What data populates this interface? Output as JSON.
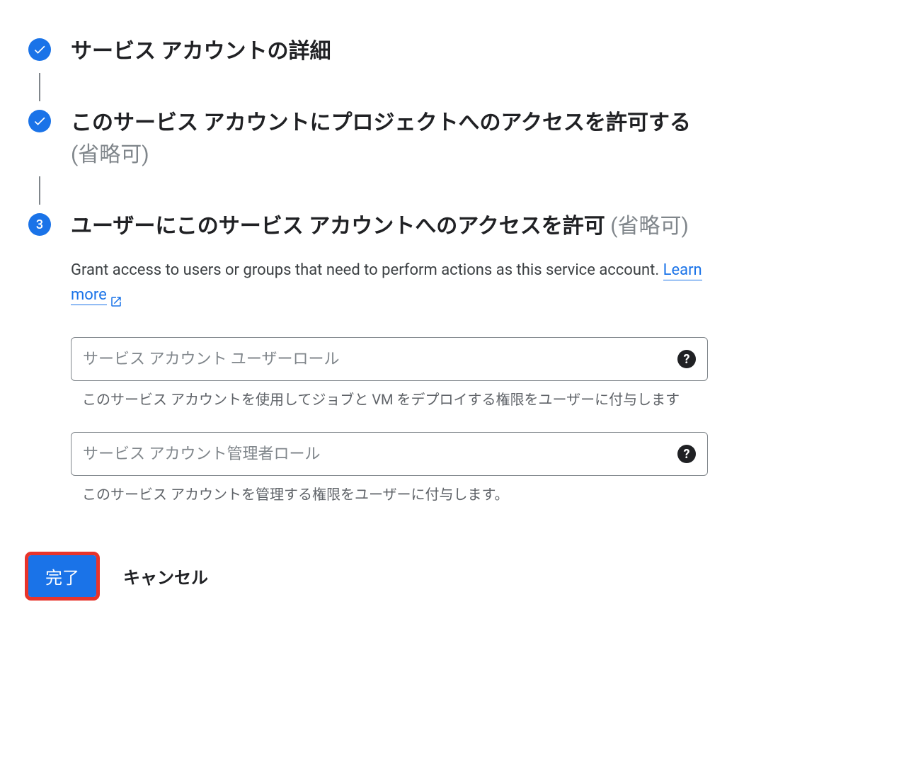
{
  "steps": {
    "step1": {
      "title": "サービス アカウントの詳細"
    },
    "step2": {
      "title_main": "このサービス アカウントにプロジェクトへのアクセスを許可する ",
      "title_opt": "(省略可)"
    },
    "step3": {
      "number": "3",
      "title_main": "ユーザーにこのサービス アカウントへのアクセスを許可 ",
      "title_opt": "(省略可)",
      "desc_pre": "Grant access to users or groups that need to perform actions as this service account. ",
      "learn_more": "Learn more"
    }
  },
  "fields": {
    "user_role": {
      "placeholder": "サービス アカウント ユーザーロール",
      "hint": "このサービス アカウントを使用してジョブと VM をデプロイする権限をユーザーに付与します"
    },
    "admin_role": {
      "placeholder": "サービス アカウント管理者ロール",
      "hint": "このサービス アカウントを管理する権限をユーザーに付与します。"
    }
  },
  "actions": {
    "done": "完了",
    "cancel": "キャンセル"
  },
  "help_glyph": "?"
}
